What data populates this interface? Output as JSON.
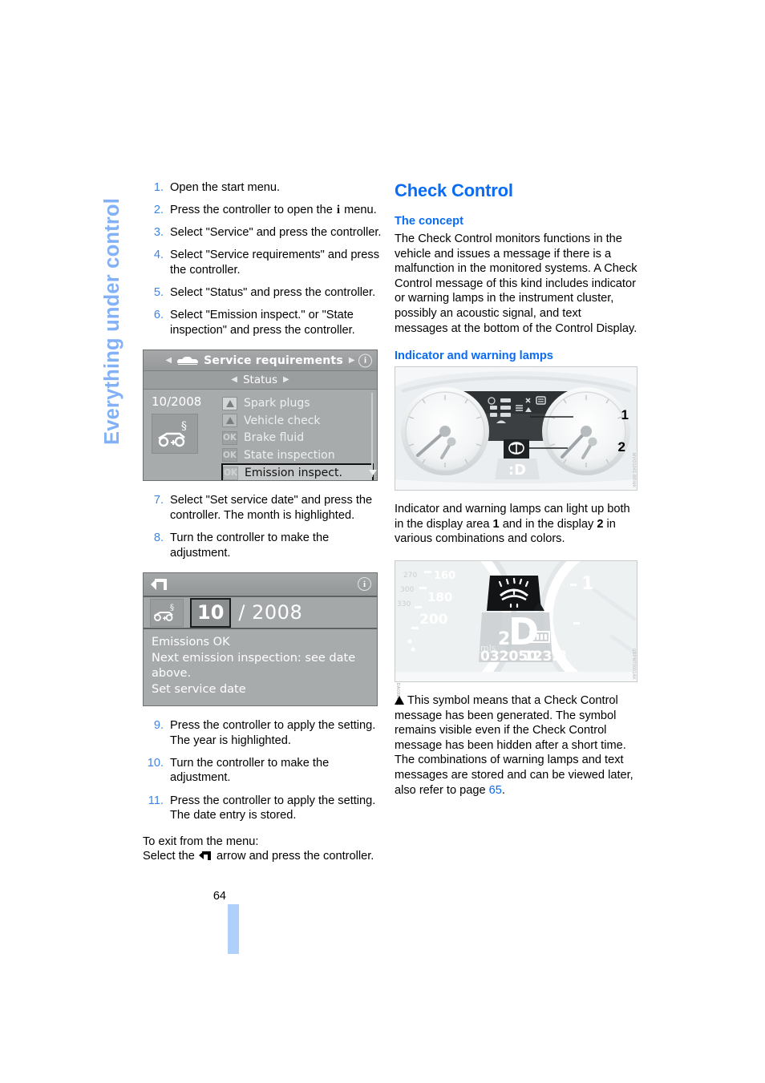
{
  "chapter_tab": "Everything under control",
  "page_number": "64",
  "left_column": {
    "steps": [
      {
        "num": "1.",
        "text": "Open the start menu."
      },
      {
        "num": "2.",
        "text_before": "Press the controller to open the ",
        "glyph": "i",
        "text_after": " menu."
      },
      {
        "num": "3.",
        "text": "Select \"Service\" and press the controller."
      },
      {
        "num": "4.",
        "text": "Select \"Service requirements\" and press the controller."
      },
      {
        "num": "5.",
        "text": "Select \"Status\" and press the controller."
      },
      {
        "num": "6.",
        "text": "Select \"Emission inspect.\" or \"State inspection\" and press the controller."
      },
      {
        "num": "7.",
        "text": "Select \"Set service date\" and press the controller. The month is highlighted."
      },
      {
        "num": "8.",
        "text": "Turn the controller to make the adjustment."
      },
      {
        "num": "9.",
        "text": "Press the controller to apply the setting. The year is highlighted."
      },
      {
        "num": "10.",
        "text": "Turn the controller to make the adjustment."
      },
      {
        "num": "11.",
        "text": "Press the controller to apply the setting. The date entry is stored."
      }
    ],
    "exit_line_1": "To exit from the menu:",
    "exit_line_2_before": "Select the ",
    "exit_line_2_after": " arrow and press the controller.",
    "screenshot_service": {
      "title": "Service requirements",
      "subtitle": "Status",
      "info_glyph": "i",
      "date": "10/2008",
      "rows": [
        {
          "badge": "warn",
          "label": "Spark plugs"
        },
        {
          "badge": "warn-dim",
          "label": "Vehicle check"
        },
        {
          "badge": "OK",
          "label": "Brake fluid"
        },
        {
          "badge": "OK",
          "label": "State inspection"
        },
        {
          "badge": "OK",
          "label": "Emission inspect.",
          "selected": true
        }
      ],
      "image_code": "0411-48-99-08"
    },
    "screenshot_date": {
      "info_glyph": "i",
      "month": "10",
      "separator": "/",
      "year": "2008",
      "message_lines": [
        "Emissions OK",
        "Next emission inspection: see date",
        "above.",
        "Set service date"
      ],
      "image_code": "SRPNDA0996AK"
    }
  },
  "right_column": {
    "heading": "Check Control",
    "concept_heading": "The concept",
    "concept_text": "The Check Control monitors functions in the vehicle and issues a message if there is a malfunction in the monitored systems. A Check Control message of this kind includes indicator or warning lamps in the instrument cluster, possibly an acoustic signal, and text messages at the bottom of the Control Display.",
    "lamps_heading": "Indicator and warning lamps",
    "cluster_photo": {
      "callout_1": "1",
      "callout_2": "2",
      "image_code": "MVO1041-BRWK"
    },
    "lamps_text_part1": "Indicator and warning lamps can light up both in the display area ",
    "lamps_bold1": "1",
    "lamps_text_part2": " and in the display ",
    "lamps_bold2": "2",
    "lamps_text_part3": " in various combinations and colors.",
    "display_photo": {
      "speed_labels": [
        "270",
        "300",
        "330",
        "160",
        "180",
        "200"
      ],
      "gear": "2D",
      "unit": "mls",
      "odometer": "032050",
      "trip": "123.8",
      "callout_1": "1",
      "image_code": "SRPNT0001AK"
    },
    "warning_text": "This symbol means that a Check Control message has been generated. The symbol remains visible even if the Check Control message has been hidden after a short time. The combinations of warning lamps and text messages are stored and can be viewed later, also refer to page ",
    "warning_page_link": "65",
    "warning_text_end": "."
  },
  "colors": {
    "accent_blue": "#0a6bf5",
    "step_number_blue": "#3d85e8",
    "tab_blue": "#82b1f7",
    "marker_blue": "#aed0fb"
  }
}
